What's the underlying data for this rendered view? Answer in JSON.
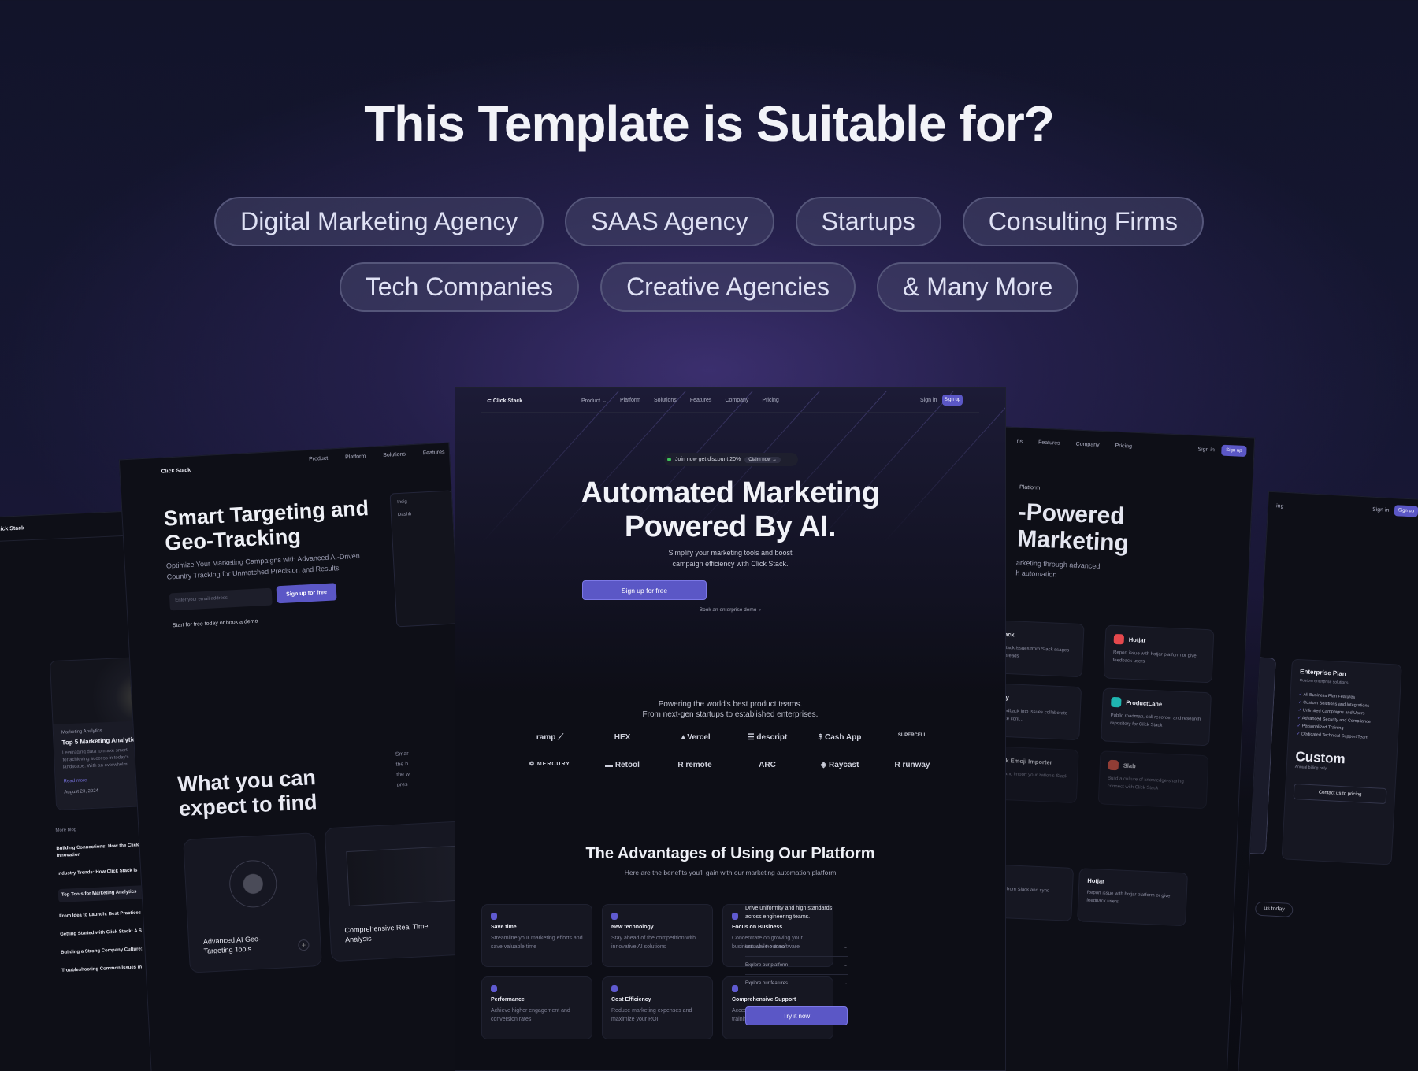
{
  "heading": "This Template is Suitable for?",
  "pills_row1": [
    "Digital Marketing Agency",
    "SAAS Agency",
    "Startups",
    "Consulting Firms"
  ],
  "pills_row2": [
    "Tech Companies",
    "Creative Agencies",
    "& Many More"
  ],
  "colors": {
    "accent": "#5b57c6",
    "background": "#0d0e16",
    "pill_bg": "#3f3f60"
  },
  "center": {
    "logo": "Click Stack",
    "nav_items": [
      "Product",
      "Platform",
      "Solutions",
      "Features",
      "Company",
      "Pricing"
    ],
    "sign_in": "Sign in",
    "sign_up": "Sign up",
    "badge_text": "Join now get discount 20%",
    "badge_cta": "Claim now →",
    "headline_1": "Automated Marketing",
    "headline_2": "Powered By AI.",
    "subtitle_1": "Simplify your marketing tools and boost",
    "subtitle_2": "campaign efficiency with Click Stack.",
    "cta": "Sign up for free",
    "demo_link": "Book an enterprise demo",
    "powering_1": "Powering the world's best product teams.",
    "powering_2": "From next-gen startups to established enterprises.",
    "logos_row1": [
      "ramp ⟋",
      "HEX",
      "▲Vercel",
      "☰ descript",
      "$ Cash App",
      "SUPERCELL"
    ],
    "logos_row2": [
      "❂ MERCURY",
      "▬ Retool",
      "R remote",
      "ARC",
      "◈ Raycast",
      "R runway"
    ],
    "adv_title": "The Advantages of Using Our Platform",
    "adv_subtitle": "Here are the benefits you'll gain with our marketing automation platform",
    "adv_cards": [
      {
        "title": "Save time",
        "desc": "Streamline your marketing efforts and save valuable time",
        "icon": "stopwatch-icon"
      },
      {
        "title": "New technology",
        "desc": "Stay ahead of the competition with innovative AI solutions",
        "icon": "gear-icon"
      },
      {
        "title": "Focus on Business",
        "desc": "Concentrate on growing your business while our software",
        "icon": "chart-icon"
      },
      {
        "title": "Performance",
        "desc": "Achieve higher engagement and conversion rates",
        "icon": "globe-icon"
      },
      {
        "title": "Cost Efficiency",
        "desc": "Reduce marketing expenses and maximize your ROI",
        "icon": "dollar-icon"
      },
      {
        "title": "Comprehensive Support",
        "desc": "Access dedicated support and training resources",
        "icon": "help-icon"
      }
    ],
    "side_text": "Drive uniformity and high standards across engineering teams.",
    "side_links": [
      "Let's see the demo",
      "Explore our platform",
      "Explore our features"
    ],
    "side_cta": "Try it now"
  },
  "left": {
    "logo": "Click Stack",
    "nav_items": [
      "Product",
      "Platform",
      "Solutions",
      "Features"
    ],
    "headline_1": "Smart Targeting and",
    "headline_2": "Geo-Tracking",
    "sub_1": "Optimize Your Marketing Campaigns with Advanced AI-Driven",
    "sub_2": "Country Tracking for Unmatched Precision and Results",
    "email_placeholder": "Enter your email address",
    "cta": "Sign up for free",
    "note": "Start for free today or book a demo",
    "section_1": "What you can",
    "section_2": "expect to find",
    "card_1": "Advanced AI Geo-Targeting Tools",
    "card_2": "Comprehensive Real Time Analysis",
    "side_fragments": [
      "Insig",
      "Dashb",
      "Smar",
      "the h",
      "the w",
      "pres"
    ]
  },
  "leftmost": {
    "logo": "Click Stack",
    "category": "Marketing Analytics",
    "title": "Top 5 Marketing Analytics",
    "excerpt": [
      "Leveraging data to make smart",
      "for achieving success in today's",
      "landscape. With an overwhelmi"
    ],
    "read_more": "Read more",
    "date": "August 23, 2024",
    "more_blog": "More blog",
    "items": [
      "Building Connections: How the Click Drives Innovation",
      "Industry Trends: How Click Stack is",
      "Top Tools for Marketing Analytics",
      "From Idea to Launch: Best Practices",
      "Getting Started with Click Stack: A S",
      "Building a Strong Company Culture:",
      "Troubleshooting Common Issues in"
    ]
  },
  "right": {
    "nav_items": [
      "ns",
      "Features",
      "Company",
      "Pricing"
    ],
    "sign_in": "Sign in",
    "sign_up": "Sign up",
    "eyebrow": "Platform",
    "headline_1": "-Powered",
    "headline_2": "Marketing",
    "sub_1": "arketing through advanced",
    "sub_2": "h automation",
    "integrations": [
      {
        "name": "Slack",
        "desc": "ate Click Stack issues from Slack ssages and sync threads"
      },
      {
        "name": "Hotjar",
        "desc": "Report issue with hotjar platform or give feedback users"
      },
      {
        "name": "Olvy",
        "desc": "vert user feedback into issues collaborate with complete cont..."
      },
      {
        "name": "ProductLane",
        "desc": "Public roadmap, call recorder and research repository for Click Stack"
      },
      {
        "name": "Slack Emoji Importer",
        "desc": "ustom emoji and import your zation's Slack emoji"
      },
      {
        "name": "Slab",
        "desc": "Build a culture of knowledge-sharing connect with Click Stack"
      }
    ],
    "lower": [
      {
        "name": "ack",
        "desc": "ck Stack issues from Slack and sync threads"
      },
      {
        "name": "Hotjar",
        "desc": "Report issue with hotjar platform or give feedback users"
      }
    ]
  },
  "rightmost": {
    "nav_fragment": "ing",
    "sign_in": "Sign in",
    "sign_up": "Sign up",
    "plan": "Enterprise Plan",
    "plan_sub": "Custom enterprise solutions.",
    "features": [
      "All Business Plan Features",
      "Custom Solutions and Integrations",
      "Unlimited Campaigns and Users",
      "Advanced Security and Compliance",
      "Personalized Training",
      "Dedicated Technical Support Team"
    ],
    "price": "Custom",
    "billing": "Annual billing only",
    "cta": "Contact us to pricing",
    "contact_fragment": "us today"
  }
}
